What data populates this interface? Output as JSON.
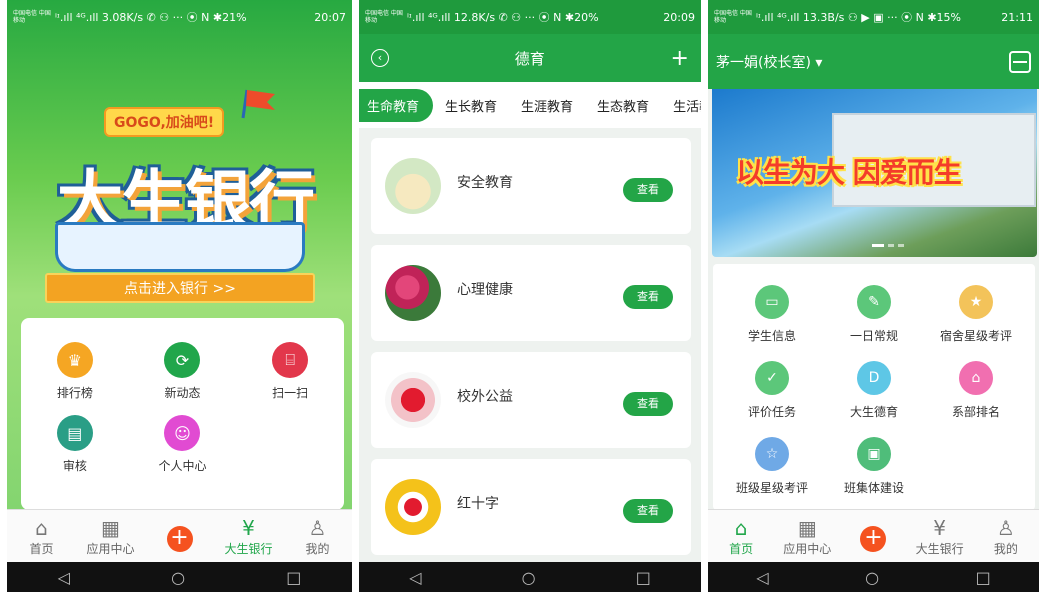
{
  "panel1": {
    "status": {
      "carrier": "中国电信 中国移动",
      "signal": "ⁱᶦ.ıll ⁴ᴳ.ıll 3.08K/s ✆ ⚇ ··· ⦿ N ✱21%",
      "time": "20:07"
    },
    "badge": "GOGO,加油吧!",
    "title": "大生银行",
    "enter_label": "点击进入银行 >>",
    "grid": [
      {
        "label": "排行榜",
        "icon": "crown-icon",
        "color": "#f5a623"
      },
      {
        "label": "新动态",
        "icon": "refresh-icon",
        "color": "#21a64b"
      },
      {
        "label": "扫一扫",
        "icon": "scan-icon",
        "color": "#e2374b"
      },
      {
        "label": "审核",
        "icon": "clipboard-icon",
        "color": "#2a9e86"
      },
      {
        "label": "个人中心",
        "icon": "smile-icon",
        "color": "#e14bd2"
      }
    ],
    "tabs": [
      {
        "label": "首页",
        "icon": "home-icon"
      },
      {
        "label": "应用中心",
        "icon": "apps-icon"
      },
      {
        "label": "",
        "icon": "plus-icon"
      },
      {
        "label": "大生银行",
        "icon": "yen-icon"
      },
      {
        "label": "我的",
        "icon": "user-icon"
      }
    ]
  },
  "panel2": {
    "status": {
      "carrier": "中国电信 中国移动",
      "signal": "ⁱᶦ.ıll ⁴ᴳ.ıll 12.8K/s ✆ ⚇ ··· ⦿ N ✱20%",
      "time": "20:09"
    },
    "title": "德育",
    "tabs": [
      "生命教育",
      "生长教育",
      "生涯教育",
      "生态教育",
      "生活教育"
    ],
    "items": [
      {
        "name": "安全教育",
        "button": "查看"
      },
      {
        "name": "心理健康",
        "button": "查看"
      },
      {
        "name": "校外公益",
        "button": "查看"
      },
      {
        "name": "红十字",
        "button": "查看"
      }
    ]
  },
  "panel3": {
    "status": {
      "carrier": "中国电信 中国移动",
      "signal": "ⁱᶦ.ıll ⁴ᴳ.ıll 13.3B/s ⚇ ▶ ▣ ··· ⦿ N ✱15%",
      "time": "21:11"
    },
    "user": "茅一娟(校长室) ▾",
    "slogan": "以生为大 因爱而生",
    "grid": [
      {
        "label": "学生信息",
        "icon": "id-card-icon",
        "color": "#5cc77a"
      },
      {
        "label": "一日常规",
        "icon": "edit-icon",
        "color": "#5cc77a"
      },
      {
        "label": "宿舍星级考评",
        "icon": "star-rating-icon",
        "color": "#f3c35a"
      },
      {
        "label": "评价任务",
        "icon": "task-icon",
        "color": "#5cc77a"
      },
      {
        "label": "大生德育",
        "icon": "dsy-icon",
        "color": "#5ec7e6"
      },
      {
        "label": "系部排名",
        "icon": "home-rank-icon",
        "color": "#f16fb0"
      },
      {
        "label": "班级星级考评",
        "icon": "class-star-icon",
        "color": "#6fa9e6"
      },
      {
        "label": "班集体建设",
        "icon": "blackboard-icon",
        "color": "#4fbd7a"
      }
    ],
    "tabs": [
      {
        "label": "首页",
        "icon": "home-icon"
      },
      {
        "label": "应用中心",
        "icon": "apps-icon"
      },
      {
        "label": "",
        "icon": "plus-icon"
      },
      {
        "label": "大生银行",
        "icon": "yen-icon"
      },
      {
        "label": "我的",
        "icon": "user-icon"
      }
    ]
  },
  "nav": {
    "back": "◁",
    "home": "○",
    "recent": "□"
  }
}
